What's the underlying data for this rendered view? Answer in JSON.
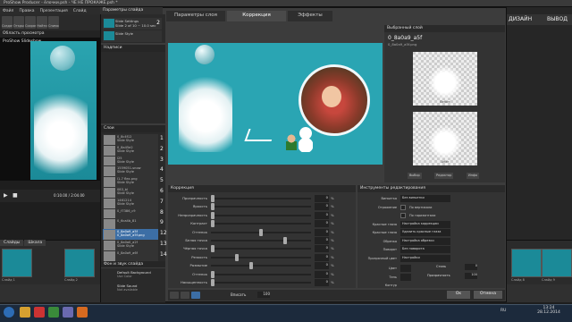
{
  "app": {
    "title": "ProShow Producer - ёлочки.psh - ЧЕ НЕ ПРОКАЖЕ.psh *",
    "menu": [
      "Файл",
      "Правка",
      "Презентация",
      "Слайд",
      "Звук",
      "Сервис"
    ],
    "toolbar": [
      "Создать",
      "Открыть",
      "Сохранить",
      "Найти",
      "Снимок"
    ],
    "preview_label": "Область просмотра",
    "preview_title": "ProShow Slideshow",
    "time": "0:10.00 / 2:04.00"
  },
  "dialog": {
    "title": "Параметры слайда",
    "tabs": [
      "Параметры слоя",
      "Коррекция",
      "Эффекты"
    ],
    "slides": [
      {
        "label": "Slide Settings",
        "sub": "Slide 2 of 10 ~ 10.0 sec",
        "num": "2"
      },
      {
        "label": "Slide Style",
        "sub": "",
        "num": ""
      }
    ],
    "captions_label": "Надписи",
    "layers_label": "Слои",
    "layers": [
      {
        "name": "0_8c4f12",
        "sub": "Slide Style",
        "num": "1"
      },
      {
        "name": "0_8a45e2",
        "sub": "Slide Style",
        "num": "2"
      },
      {
        "name": "l25",
        "sub": "Slide Style",
        "num": "3"
      },
      {
        "name": "1559051-snow",
        "sub": "Slide Style",
        "num": "4"
      },
      {
        "name": "l1-7 flex.png",
        "sub": "Slide Style",
        "num": "5"
      },
      {
        "name": "083_bl",
        "sub": "Slide Style",
        "num": "6"
      },
      {
        "name": "1461214",
        "sub": "Slide Style",
        "num": "7"
      },
      {
        "name": "0_f7386_c9",
        "sub": "",
        "num": "8"
      },
      {
        "name": "0_6ca4b_81",
        "sub": "",
        "num": "9"
      },
      {
        "name": "0_8a0a9_a5f",
        "sub": "0_8a0a9_a5f.png",
        "num": "12"
      },
      {
        "name": "0_8a0a0_a2f",
        "sub": "Slide Style",
        "num": "13"
      },
      {
        "name": "0_8a0a9_a6f",
        "sub": "",
        "num": "14"
      }
    ],
    "sounds_label": "Фон и звук слайда",
    "bg_label": "Default Background",
    "bg_sub": "Use Color",
    "sound_label": "Slide Sound",
    "sound_sub": "Not available",
    "selected_layer": {
      "panel_title": "Выбранный слой",
      "name": "0_8a0a9_a5f",
      "file": "0_8a0a9_a5f.png",
      "before": "Before",
      "after": "After",
      "btns": [
        "Выбор",
        "Редактор",
        "Инфо"
      ]
    },
    "correction": {
      "title": "Коррекция",
      "rows": [
        {
          "label": "Прозрачность",
          "value": "0",
          "pct": "%",
          "pos": 0.0
        },
        {
          "label": "Яркость",
          "value": "0",
          "pct": "%",
          "pos": 0.0
        },
        {
          "label": "Непрозрачность",
          "value": "0",
          "pct": "%",
          "pos": 0.0
        },
        {
          "label": "Контраст",
          "value": "0",
          "pct": "%",
          "pos": 0.0
        },
        {
          "label": "Оттенок",
          "value": "0",
          "pct": "%",
          "pos": 0.5
        },
        {
          "label": "Белая точка",
          "value": "0",
          "pct": "%",
          "pos": 0.75
        },
        {
          "label": "Чёрная точка",
          "value": "0",
          "pct": "%",
          "pos": 0.0
        },
        {
          "label": "Резкость",
          "value": "0",
          "pct": "%",
          "pos": 0.25
        },
        {
          "label": "Размытие",
          "value": "0",
          "pct": "%",
          "pos": 0.4
        },
        {
          "label": "Оттенок",
          "value": "0",
          "pct": "%",
          "pos": 0.0
        },
        {
          "label": "Насыщенность",
          "value": "0",
          "pct": "%",
          "pos": 0.0
        }
      ]
    },
    "editing": {
      "title": "Инструменты редактирования",
      "rows": [
        {
          "label": "Виньетка",
          "box": "Без виньетки"
        },
        {
          "label": "Отражение",
          "check": "По вертикали"
        },
        {
          "label": "",
          "check": "По горизонтали"
        },
        {
          "label": "Красные глаза",
          "box": "Настройка коррекции"
        },
        {
          "label": "Красные глаза",
          "box": "Удалить красные глаза"
        },
        {
          "label": "Обрезка",
          "box": "Настройка обрезки"
        },
        {
          "label": "Поворот",
          "box": "Без поворота"
        },
        {
          "label": "Прозрачный цвет",
          "box": "Настройки"
        }
      ],
      "color_label": "Цвет",
      "color2_label": "Тень",
      "contour_label": "Контур",
      "stretch_label": "Стиль",
      "stretch_val": "0",
      "opacity_label": "Прозрачность",
      "opacity_val": "100"
    },
    "ok": "Ок",
    "cancel": "Отмена",
    "bottom_fit": "Вписать",
    "zoom": "100"
  },
  "timeline": {
    "tabs": [
      "Слайды",
      "Шкала"
    ],
    "slides": [
      {
        "label": "Слайд 1",
        "time": "3.0"
      },
      {
        "label": "Слайд 2",
        "time": "3.0"
      },
      {
        "label": "Слайд 8",
        "time": "3.0"
      },
      {
        "label": "Слайд 9",
        "time": "2.0"
      }
    ]
  },
  "right_tabs": [
    "ДИЗАЙН",
    "ВЫВОД"
  ],
  "taskbar": {
    "lang": "RU",
    "time": "13:24",
    "date": "28.12.2014"
  }
}
